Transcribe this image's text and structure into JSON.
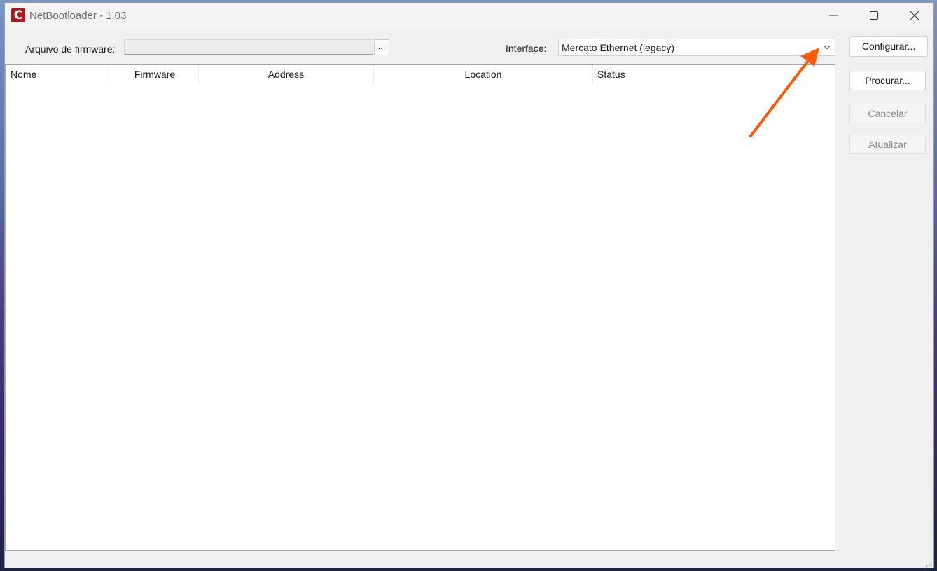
{
  "window": {
    "title": "NetBootloader - 1.03",
    "app_icon_letter": "C"
  },
  "toolbar": {
    "firmware_label": "Arquivo de firmware:",
    "firmware_value": "",
    "browse_label": "...",
    "interface_label": "Interface:",
    "interface_value": "Mercato Ethernet (legacy)"
  },
  "sidebar": {
    "configure": "Configurar...",
    "search": "Procurar...",
    "cancel": "Cancelar",
    "refresh": "Atualizar"
  },
  "table": {
    "columns": [
      "Nome",
      "Firmware",
      "Address",
      "Location",
      "Status"
    ],
    "rows": []
  },
  "colors": {
    "accent_arrow": "#ff5a0a",
    "app_icon": "#a11d22"
  }
}
